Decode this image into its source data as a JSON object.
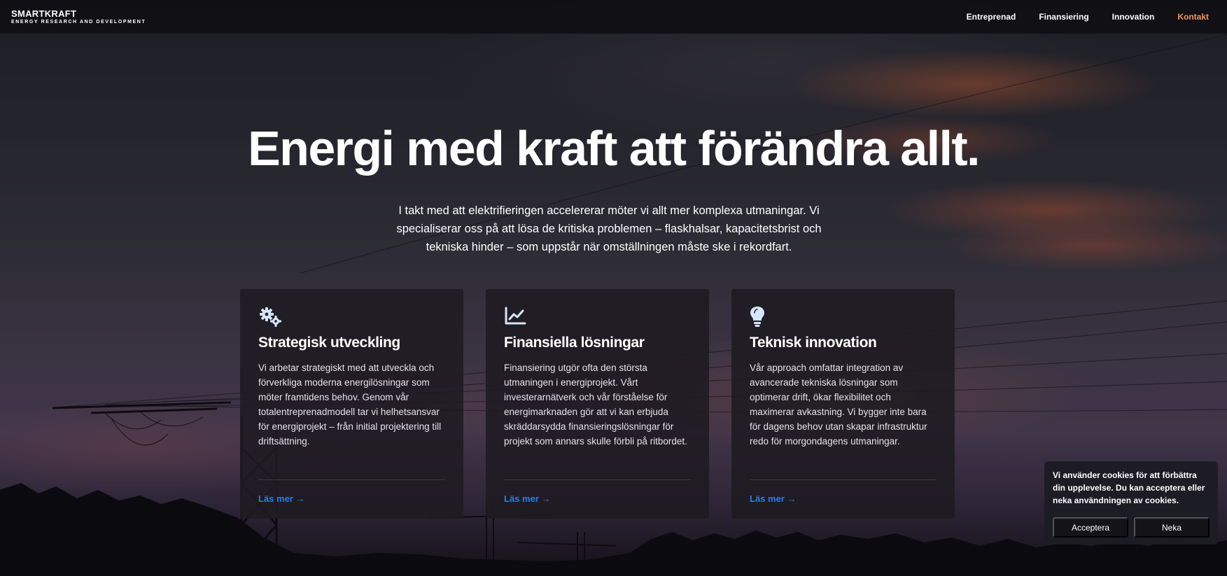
{
  "nav": {
    "brand_name": "SMARTKRAFT",
    "brand_tagline": "ENERGY RESEARCH AND DEVELOPMENT",
    "links": [
      "Entreprenad",
      "Finansiering",
      "Innovation"
    ],
    "cta": "Kontakt"
  },
  "hero": {
    "title": "Energi med kraft att förändra allt.",
    "text": "I takt med att elektrifieringen accelererar möter vi allt mer komplexa utmaningar. Vi specialiserar oss på att lösa de kritiska problemen – flaskhalsar, kapacitetsbrist och tekniska hinder – som uppstår när omställningen måste ske i rekordfart."
  },
  "cards": [
    {
      "icon": "gears-icon",
      "title": "Strategisk utveckling",
      "text": "Vi arbetar strategiskt med att utveckla och förverkliga moderna energilösningar som möter framtidens behov. Genom vår totalentreprenadmodell tar vi helhetsansvar för energiprojekt – från initial projektering till driftsättning.",
      "link": "Läs mer →"
    },
    {
      "icon": "chart-line-icon",
      "title": "Finansiella lösningar",
      "text": "Finansiering utgör ofta den största utmaningen i energiprojekt. Vårt investerarnätverk och vår förståelse för energimarknaden gör att vi kan erbjuda skräddarsydda finansieringslösningar för projekt som annars skulle förbli på ritbordet.",
      "link": "Läs mer →"
    },
    {
      "icon": "lightbulb-icon",
      "title": "Teknisk innovation",
      "text": "Vår approach omfattar integration av avancerade tekniska lösningar som optimerar drift, ökar flexibilitet och maximerar avkastning. Vi bygger inte bara för dagens behov utan skapar infrastruktur redo för morgondagens utmaningar.",
      "link": "Läs mer →"
    }
  ],
  "cookie": {
    "text": "Vi använder cookies för att förbättra din upplevelse. Du kan acceptera eller neka användningen av cookies.",
    "accept": "Acceptera",
    "decline": "Neka"
  },
  "colors": {
    "accent_cta": "#f0955c",
    "link": "#2b7de9",
    "icon": "#d6e6ff"
  }
}
